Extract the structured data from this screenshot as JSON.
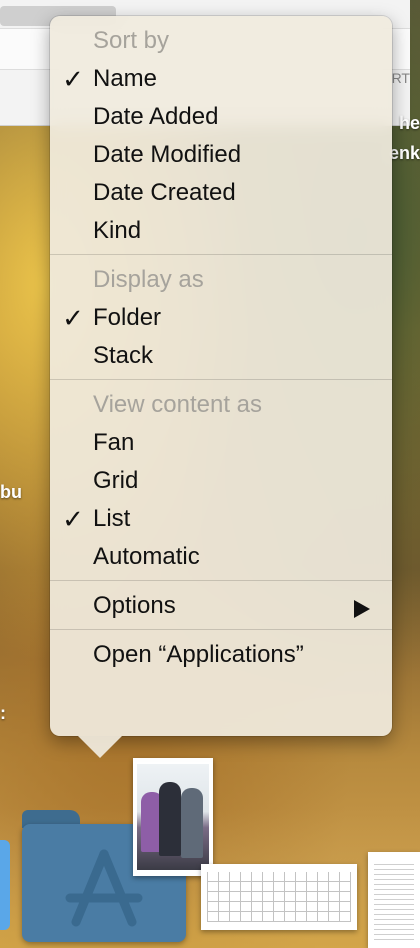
{
  "menu": {
    "sort_by": {
      "header": "Sort by",
      "items": [
        {
          "label": "Name",
          "checked": true
        },
        {
          "label": "Date Added",
          "checked": false
        },
        {
          "label": "Date Modified",
          "checked": false
        },
        {
          "label": "Date Created",
          "checked": false
        },
        {
          "label": "Kind",
          "checked": false
        }
      ]
    },
    "display_as": {
      "header": "Display as",
      "items": [
        {
          "label": "Folder",
          "checked": true
        },
        {
          "label": "Stack",
          "checked": false
        }
      ]
    },
    "view_content_as": {
      "header": "View content as",
      "items": [
        {
          "label": "Fan",
          "checked": false
        },
        {
          "label": "Grid",
          "checked": false
        },
        {
          "label": "List",
          "checked": true
        },
        {
          "label": "Automatic",
          "checked": false
        }
      ]
    },
    "options_label": "Options",
    "open_label": "Open “Applications”",
    "checkmark": "✓"
  },
  "background": {
    "right_text_1": "he",
    "right_text_2": "enk",
    "right_text_small": "RT",
    "left_text": "bu",
    "left_text_2": ":"
  },
  "colors": {
    "menu_bg": "#F0EBDE",
    "header_text": "#A6A39C",
    "folder_blue": "#4A7CA4"
  }
}
